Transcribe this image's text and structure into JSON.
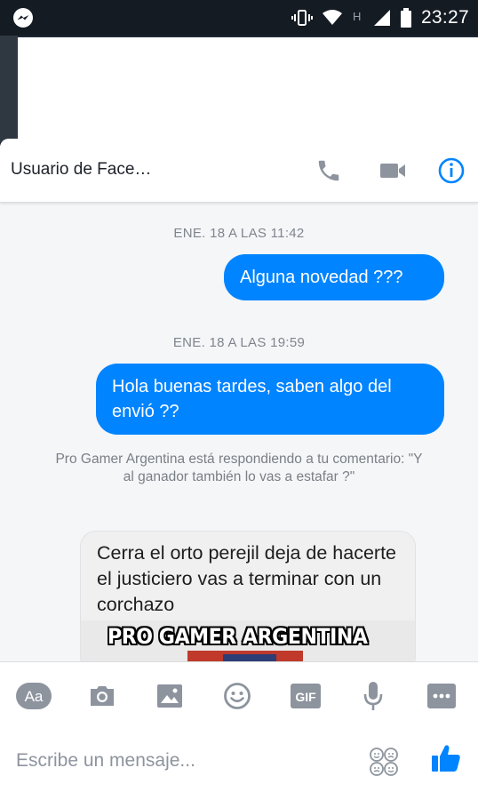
{
  "status_bar": {
    "time": "23:27",
    "icons": [
      "messenger-icon",
      "vibrate-icon",
      "wifi-icon",
      "network-h-icon",
      "signal-icon",
      "battery-icon"
    ]
  },
  "header": {
    "title": "Usuario de Face…",
    "icons": [
      "phone-icon",
      "video-call-icon",
      "info-icon"
    ],
    "accent": "#0084ff"
  },
  "conversation": {
    "timestamp_1": "ENE. 18 A LAS 11:42",
    "message_1": "Alguna novedad ???",
    "timestamp_2": "ENE. 18 A LAS 19:59",
    "message_2": "Hola buenas tardes, saben algo del envió ??",
    "reply_note": "Pro Gamer Argentina está respondiendo a tu comentario: \"Y al ganador también lo vas a estafar ?\"",
    "incoming_message": "Cerra el orto perejil deja de hacerte el justiciero vas a terminar con un corchazo",
    "image_caption": "PRO GAMER ARGENTINA"
  },
  "composer": {
    "tools": [
      "text-format-icon",
      "camera-icon",
      "gallery-icon",
      "emoji-icon",
      "gif-icon",
      "microphone-icon",
      "more-icon"
    ],
    "placeholder": "Escribe un mensaje...",
    "aa_label": "Aa",
    "gif_label": "GIF"
  },
  "colors": {
    "outgoing_bubble": "#0084ff",
    "incoming_bubble": "#f1f0f0",
    "icon_gray": "#8d949e"
  }
}
